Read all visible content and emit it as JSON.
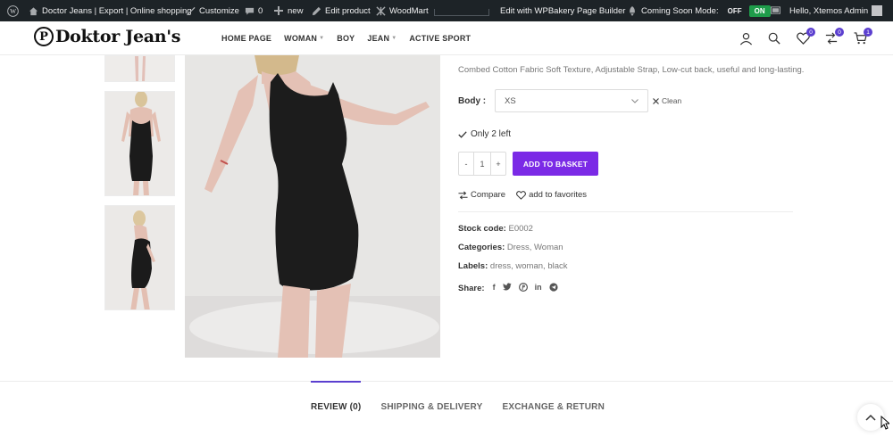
{
  "admin_bar": {
    "site_name": "Doctor Jeans | Export | Online shopping",
    "customize": "Customize",
    "comments_count": "0",
    "new_label": "new",
    "edit_product": "Edit product",
    "woodmart": "WoodMart",
    "wpbakery": "Edit with WPBakery Page Builder",
    "coming_soon_label": "Coming Soon Mode:",
    "toggle_off": "OFF",
    "toggle_on": "ON",
    "greeting": "Hello, Xtemos Admin"
  },
  "header": {
    "logo_mark": "P",
    "logo_text": "Doktor Jean's",
    "nav": [
      {
        "label": "HOME PAGE"
      },
      {
        "label": "WOMAN"
      },
      {
        "label": "BOY"
      },
      {
        "label": "JEAN"
      },
      {
        "label": "ACTIVE SPORT"
      }
    ],
    "wishlist_count": "0",
    "compare_count": "0",
    "cart_count": "1"
  },
  "product": {
    "description": "Combed Cotton Fabric Soft Texture, Adjustable Strap, Low-cut back, useful and long-lasting.",
    "variation_label": "Body",
    "variation_selected": "XS",
    "clean_label": "Clean",
    "stock_text": "Only 2 left",
    "quantity": "1",
    "qty_minus": "-",
    "qty_plus": "+",
    "add_to_basket": "ADD TO BASKET",
    "compare_label": "Compare",
    "favorites_label": "add to favorites",
    "stock_code_label": "Stock code:",
    "stock_code": "E0002",
    "categories_label": "Categories:",
    "categories": "Dress, Woman",
    "labels_label": "Labels:",
    "labels": "dress, woman, black",
    "share_label": "Share:",
    "share_icons": [
      "f",
      "t",
      "p",
      "in",
      "tg"
    ]
  },
  "tabs": [
    {
      "label": "REVIEW (0)",
      "active": true
    },
    {
      "label": "SHIPPING & DELIVERY",
      "active": false
    },
    {
      "label": "EXCHANGE & RETURN",
      "active": false
    }
  ],
  "colors": {
    "accent": "#5b3fcf",
    "button": "#7b2ae6",
    "admin_bar": "#1d2327",
    "toggle_on": "#1e9c4a"
  }
}
